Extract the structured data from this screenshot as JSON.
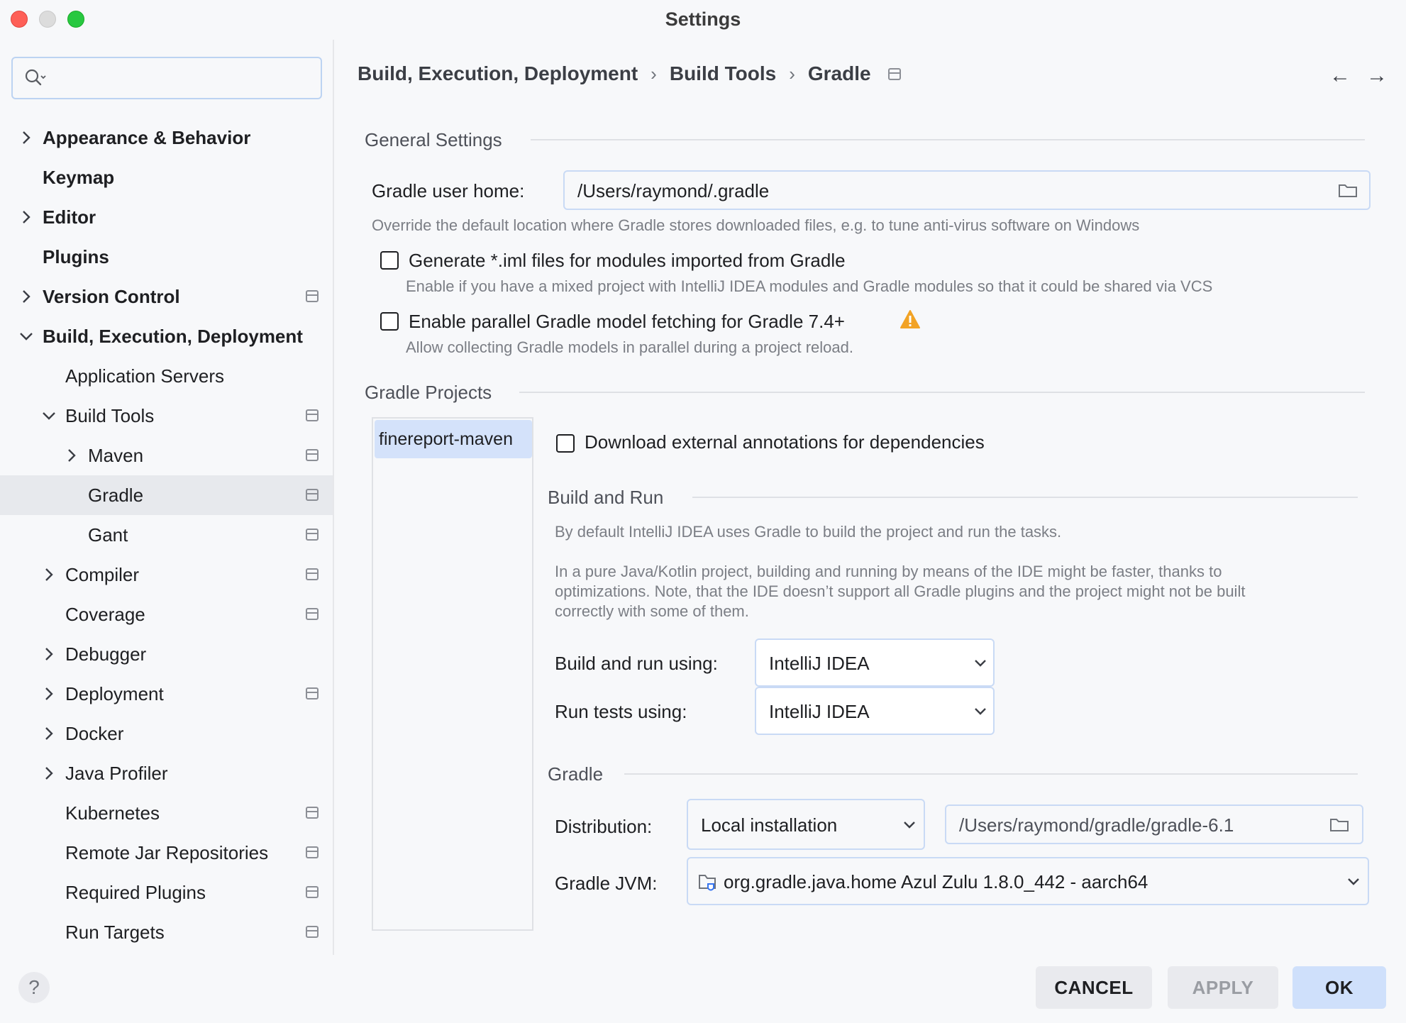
{
  "window": {
    "title": "Settings"
  },
  "search": {
    "placeholder": ""
  },
  "sidebar": {
    "items": [
      {
        "label": "Appearance & Behavior",
        "bold": true
      },
      {
        "label": "Keymap",
        "bold": true
      },
      {
        "label": "Editor",
        "bold": true
      },
      {
        "label": "Plugins",
        "bold": true
      },
      {
        "label": "Version Control",
        "bold": true
      },
      {
        "label": "Build, Execution, Deployment",
        "bold": true
      },
      {
        "label": "Application Servers"
      },
      {
        "label": "Build Tools"
      },
      {
        "label": "Maven"
      },
      {
        "label": "Gradle",
        "selected": true
      },
      {
        "label": "Gant"
      },
      {
        "label": "Compiler"
      },
      {
        "label": "Coverage"
      },
      {
        "label": "Debugger"
      },
      {
        "label": "Deployment"
      },
      {
        "label": "Docker"
      },
      {
        "label": "Java Profiler"
      },
      {
        "label": "Kubernetes"
      },
      {
        "label": "Remote Jar Repositories"
      },
      {
        "label": "Required Plugins"
      },
      {
        "label": "Run Targets"
      }
    ],
    "help_label": "?"
  },
  "breadcrumb": {
    "items": [
      "Build, Execution, Deployment",
      "Build Tools",
      "Gradle"
    ],
    "separator": "›",
    "back": "←",
    "forward": "→"
  },
  "general": {
    "title": "General Settings",
    "user_home_label": "Gradle user home:",
    "user_home_value": "/Users/raymond/.gradle",
    "user_home_hint": "Override the default location where Gradle stores downloaded files, e.g. to tune anti-virus software on Windows",
    "iml_label": "Generate *.iml files for modules imported from Gradle",
    "iml_checked": false,
    "iml_hint": "Enable if you have a mixed project with IntelliJ IDEA modules and Gradle modules so that it could be shared via VCS",
    "parallel_label": "Enable parallel Gradle model fetching for Gradle 7.4+",
    "parallel_checked": false,
    "parallel_hint": "Allow collecting Gradle models in parallel during a project reload."
  },
  "projects": {
    "title": "Gradle Projects",
    "list": [
      "finereport-maven"
    ],
    "download_annotations_label": "Download external annotations for dependencies",
    "download_annotations_checked": false
  },
  "build_run": {
    "title": "Build and Run",
    "hint1": "By default IntelliJ IDEA uses Gradle to build the project and run the tasks.",
    "hint2_line1": "In a pure Java/Kotlin project, building and running by means of the IDE might be faster, thanks to",
    "hint2_line2": "optimizations. Note, that the IDE doesn’t support all Gradle plugins and the project might not be built",
    "hint2_line3": "correctly with some of them.",
    "build_using_label": "Build and run using:",
    "build_using_value": "IntelliJ IDEA",
    "tests_using_label": "Run tests using:",
    "tests_using_value": "IntelliJ IDEA"
  },
  "gradle": {
    "title": "Gradle",
    "distribution_label": "Distribution:",
    "distribution_value": "Local installation",
    "distribution_path": "/Users/raymond/gradle/gradle-6.1",
    "jvm_label": "Gradle JVM:",
    "jvm_value": "org.gradle.java.home Azul Zulu 1.8.0_442 - aarch64"
  },
  "footer": {
    "cancel": "CANCEL",
    "apply": "APPLY",
    "ok": "OK"
  },
  "colors": {
    "accent": "#3574f0",
    "selection": "#d4e2fa",
    "warning": "#f2a325"
  }
}
